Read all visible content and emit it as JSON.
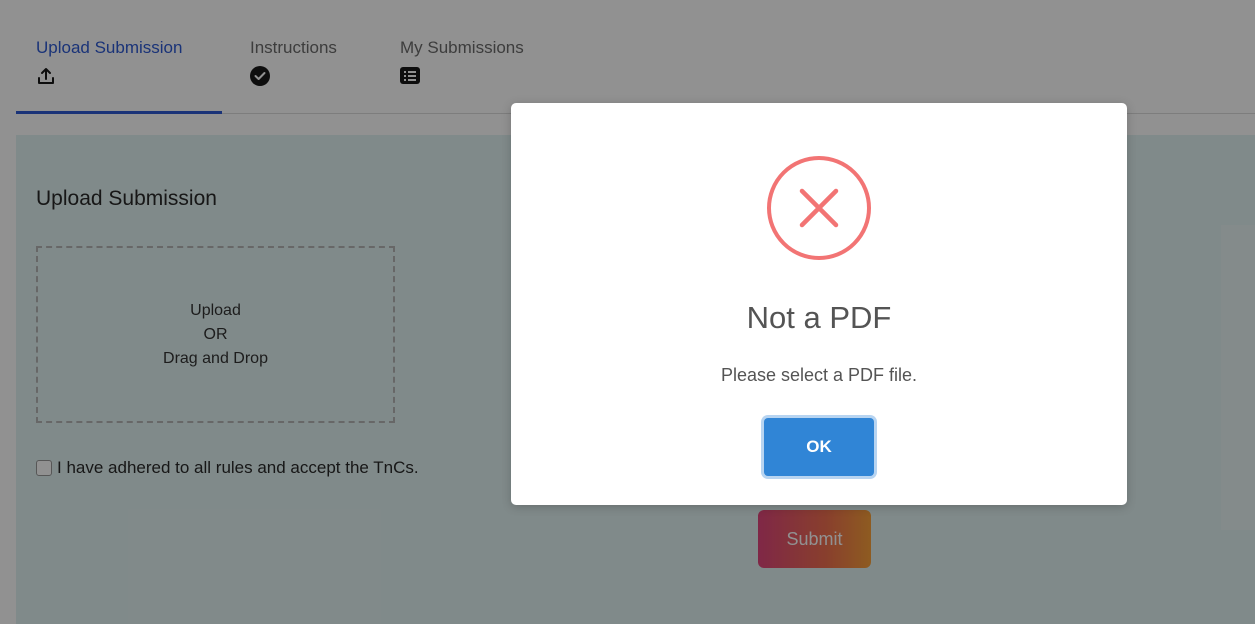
{
  "tabs": [
    {
      "label": "Upload Submission",
      "icon": "upload-icon",
      "active": true
    },
    {
      "label": "Instructions",
      "icon": "check-circle-icon",
      "active": false
    },
    {
      "label": "My Submissions",
      "icon": "list-icon",
      "active": false
    }
  ],
  "upload": {
    "title": "Upload Submission",
    "dropzone_line1": "Upload",
    "dropzone_line2": "OR",
    "dropzone_line3": "Drag and Drop",
    "terms_label": "I have adhered to all rules and accept the TnCs.",
    "submit_label": "Submit"
  },
  "modal": {
    "icon": "error-x-icon",
    "title": "Not a PDF",
    "message": "Please select a PDF file.",
    "ok_label": "OK"
  },
  "colors": {
    "accent": "#2f5bd3",
    "error": "#f27474",
    "ok_button": "#3085d6",
    "panel_bg": "#e2f3f3"
  }
}
